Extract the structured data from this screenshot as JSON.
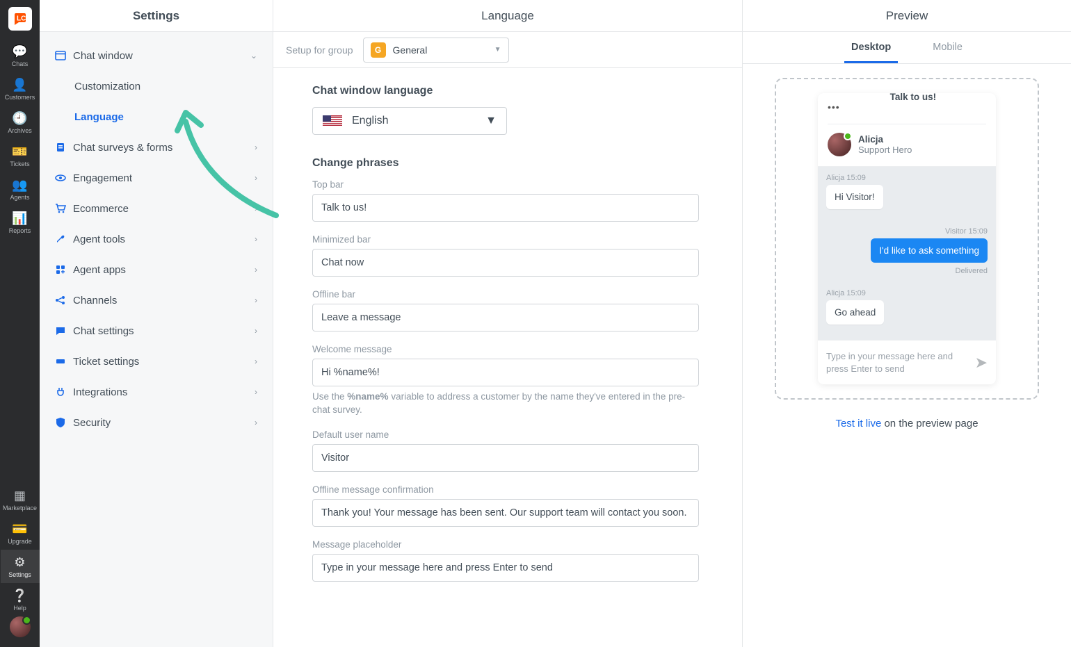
{
  "rail": {
    "items": [
      {
        "label": "Chats"
      },
      {
        "label": "Customers"
      },
      {
        "label": "Archives"
      },
      {
        "label": "Tickets"
      },
      {
        "label": "Agents"
      },
      {
        "label": "Reports"
      }
    ],
    "bottom": [
      {
        "label": "Marketplace"
      },
      {
        "label": "Upgrade"
      },
      {
        "label": "Settings"
      },
      {
        "label": "Help"
      }
    ]
  },
  "sidebar": {
    "title": "Settings",
    "sections": {
      "chat_window": {
        "label": "Chat window",
        "sub": [
          {
            "label": "Customization"
          },
          {
            "label": "Language"
          }
        ]
      },
      "surveys": {
        "label": "Chat surveys & forms"
      },
      "engagement": {
        "label": "Engagement"
      },
      "ecommerce": {
        "label": "Ecommerce"
      },
      "agent_tools": {
        "label": "Agent tools"
      },
      "agent_apps": {
        "label": "Agent apps"
      },
      "channels": {
        "label": "Channels"
      },
      "chat_settings": {
        "label": "Chat settings"
      },
      "ticket_settings": {
        "label": "Ticket settings"
      },
      "integrations": {
        "label": "Integrations"
      },
      "security": {
        "label": "Security"
      }
    }
  },
  "center": {
    "title": "Language",
    "group_label": "Setup for group",
    "group_badge": "G",
    "group_value": "General",
    "section1": "Chat window language",
    "language_value": "English",
    "section2": "Change phrases",
    "fields": {
      "top_bar": {
        "label": "Top bar",
        "value": "Talk to us!"
      },
      "minimized_bar": {
        "label": "Minimized bar",
        "value": "Chat now"
      },
      "offline_bar": {
        "label": "Offline bar",
        "value": "Leave a message"
      },
      "welcome": {
        "label": "Welcome message",
        "value": "Hi %name%!",
        "hint_pre": "Use the ",
        "hint_var": "%name%",
        "hint_post": " variable to address a customer by the name they've entered in the pre-chat survey."
      },
      "default_user": {
        "label": "Default user name",
        "value": "Visitor"
      },
      "offline_confirm": {
        "label": "Offline message confirmation",
        "value": "Thank you! Your message has been sent. Our support team will contact you soon."
      },
      "placeholder": {
        "label": "Message placeholder",
        "value": "Type in your message here and press Enter to send"
      }
    }
  },
  "preview": {
    "title": "Preview",
    "tabs": {
      "desktop": "Desktop",
      "mobile": "Mobile"
    },
    "widget": {
      "title": "Talk to us!",
      "agent_name": "Alicja",
      "agent_role": "Support Hero",
      "meta1": "Alicja 15:09",
      "msg1": "Hi Visitor!",
      "meta2": "Visitor 15:09",
      "msg2": "I'd like to ask something",
      "delivered": "Delivered",
      "meta3": "Alicja 15:09",
      "msg3": "Go ahead",
      "placeholder": "Type in your message here and press Enter to send"
    },
    "link_text": "Test it live",
    "link_suffix": " on the preview page"
  }
}
